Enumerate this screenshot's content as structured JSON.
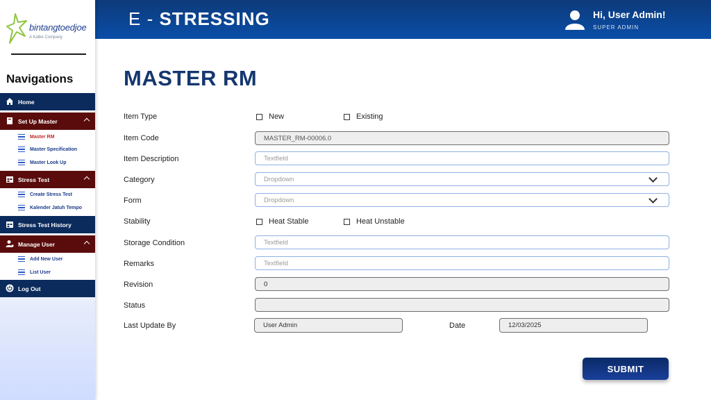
{
  "brand": {
    "logo_text": "bintangtoedjoe",
    "logo_sub": "A Kalbe Company",
    "accent": "#0b2b5c"
  },
  "header": {
    "title_prefix": "E -",
    "title_main": "STRESSING",
    "greeting": "Hi, User Admin!",
    "role": "SUPER ADMIN"
  },
  "sidebar": {
    "title": "Navigations",
    "home": "Home",
    "setup_master": "Set Up Master",
    "master_rm": "Master RM",
    "master_spec": "Master Specification",
    "master_lookup": "Master Look Up",
    "stress_test": "Stress Test",
    "create_stress": "Create Stress Test",
    "kalender": "Kalender Jatuh Tempo",
    "stress_history": "Stress Test History",
    "manage_user": "Manage User",
    "add_user": "Add New User",
    "list_user": "List User",
    "logout": "Log Out"
  },
  "form": {
    "page_title": "MASTER RM",
    "item_type_label": "Item Type",
    "item_type_new": "New",
    "item_type_existing": "Existing",
    "item_code_label": "Item Code",
    "item_code_value": "MASTER_RM-00006.0",
    "item_desc_label": "Item Description",
    "item_desc_placeholder": "Textfield",
    "category_label": "Category",
    "category_placeholder": "Dropdown",
    "form_label": "Form",
    "form_placeholder": "Dropdown",
    "stability_label": "Stability",
    "stability_stable": "Heat Stable",
    "stability_unstable": "Heat Unstable",
    "storage_label": "Storage Condition",
    "storage_placeholder": "Textfield",
    "remarks_label": "Remarks",
    "remarks_placeholder": "Textfield",
    "revision_label": "Revision",
    "revision_value": "0",
    "status_label": "Status",
    "status_value": "",
    "last_update_label": "Last Update By",
    "last_update_value": "User Admin",
    "date_label": "Date",
    "date_value": "12/03/2025",
    "submit_label": "SUBMIT"
  }
}
